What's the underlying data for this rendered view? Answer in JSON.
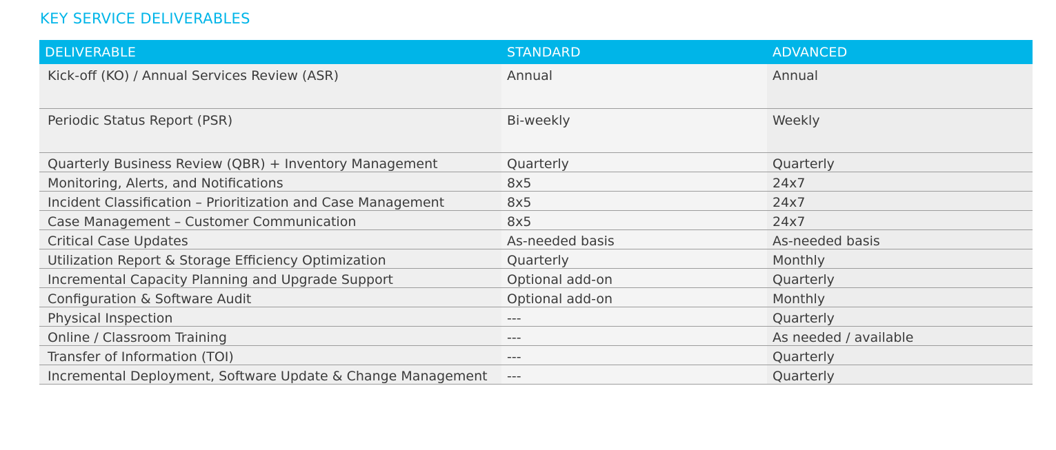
{
  "heading": "KEY SERVICE DELIVERABLES",
  "colors": {
    "accent": "#00b5e8",
    "header_bg": "#00b5e8",
    "header_text": "#ffffff",
    "row_border": "#9b9b9b"
  },
  "table": {
    "headers": [
      "DELIVERABLE",
      "STANDARD",
      "ADVANCED"
    ],
    "rows": [
      {
        "deliverable": "Kick-off (KO) / Annual Services Review (ASR)",
        "standard": "Annual",
        "advanced": "Annual"
      },
      {
        "deliverable": "Periodic Status Report (PSR)",
        "standard": "Bi-weekly",
        "advanced": "Weekly"
      },
      {
        "deliverable": "Quarterly Business Review (QBR) + Inventory Management",
        "standard": "Quarterly",
        "advanced": "Quarterly"
      },
      {
        "deliverable": "Monitoring, Alerts, and Notifications",
        "standard": "8x5",
        "advanced": "24x7"
      },
      {
        "deliverable": "Incident Classification – Prioritization and Case Management",
        "standard": "8x5",
        "advanced": "24x7"
      },
      {
        "deliverable": "Case Management – Customer Communication",
        "standard": "8x5",
        "advanced": "24x7"
      },
      {
        "deliverable": "Critical Case Updates",
        "standard": "As-needed basis",
        "advanced": "As-needed basis"
      },
      {
        "deliverable": "Utilization Report & Storage Efficiency Optimization",
        "standard": "Quarterly",
        "advanced": "Monthly"
      },
      {
        "deliverable": "Incremental Capacity Planning and Upgrade Support",
        "standard": "Optional add-on",
        "advanced": "Quarterly"
      },
      {
        "deliverable": "Configuration & Software Audit",
        "standard": "Optional add-on",
        "advanced": "Monthly"
      },
      {
        "deliverable": "Physical Inspection",
        "standard": "---",
        "advanced": "Quarterly"
      },
      {
        "deliverable": "Online / Classroom Training",
        "standard": "---",
        "advanced": "As needed / available"
      },
      {
        "deliverable": "Transfer of Information (TOI)",
        "standard": "---",
        "advanced": "Quarterly"
      },
      {
        "deliverable": "Incremental Deployment, Software Update & Change Management",
        "standard": "---",
        "advanced": "Quarterly"
      }
    ]
  }
}
